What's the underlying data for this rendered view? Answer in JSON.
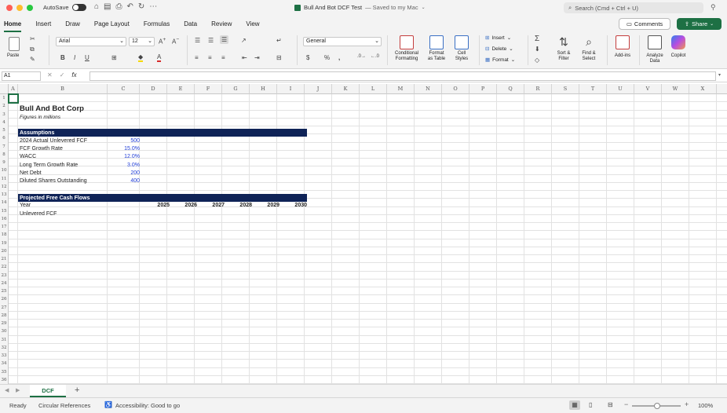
{
  "window": {
    "autosave_label": "AutoSave",
    "title": "Bull And Bot DCF Test",
    "title_suffix": "— Saved to my Mac",
    "search_placeholder": "Search (Cmd + Ctrl + U)"
  },
  "ribbon_tabs": [
    "Home",
    "Insert",
    "Draw",
    "Page Layout",
    "Formulas",
    "Data",
    "Review",
    "View"
  ],
  "ribbon_actions": {
    "comments": "Comments",
    "share": "Share"
  },
  "ribbon": {
    "paste": "Paste",
    "font_name": "Arial",
    "font_size": "12",
    "number_format": "General",
    "insert": "Insert",
    "delete": "Delete",
    "format": "Format",
    "conditional_formatting": [
      "Conditional",
      "Formatting"
    ],
    "format_as_table": [
      "Format",
      "as Table"
    ],
    "cell_styles": [
      "Cell",
      "Styles"
    ],
    "sort_filter": [
      "Sort &",
      "Filter"
    ],
    "find_select": [
      "Find &",
      "Select"
    ],
    "add_ins": "Add-ins",
    "analyze_data": [
      "Analyze",
      "Data"
    ],
    "copilot": "Copilot"
  },
  "formula_bar": {
    "name_box": "A1",
    "fx": "fx",
    "formula": ""
  },
  "columns": [
    "A",
    "B",
    "C",
    "D",
    "E",
    "F",
    "G",
    "H",
    "I",
    "J",
    "K",
    "L",
    "M",
    "N",
    "O",
    "P",
    "Q",
    "R",
    "S",
    "T",
    "U",
    "V",
    "W",
    "X",
    "Y"
  ],
  "rows": [
    "1",
    "2",
    "3",
    "4",
    "5",
    "6",
    "7",
    "8",
    "9",
    "10",
    "11",
    "12",
    "13",
    "14",
    "15",
    "16",
    "17",
    "18",
    "19",
    "20",
    "21",
    "22",
    "23",
    "24",
    "25",
    "26",
    "27",
    "28",
    "29",
    "30",
    "31",
    "32",
    "33",
    "34",
    "35",
    "36"
  ],
  "sheet": {
    "company": "Bull And Bot Corp",
    "subtitle": "Figures in millions",
    "assumptions_header": "Assumptions",
    "assumptions": [
      {
        "label": "2024 Actual Unlevered FCF",
        "value": "500"
      },
      {
        "label": "FCF Growth Rate",
        "value": "15.0%"
      },
      {
        "label": "WACC",
        "value": "12.0%"
      },
      {
        "label": "Long Term Growth Rate",
        "value": "3.0%"
      },
      {
        "label": "Net Debt",
        "value": "200"
      },
      {
        "label": "Diluted Shares Outstanding",
        "value": "400"
      }
    ],
    "projection_header": "Projected Free Cash Flows",
    "year_label": "Year",
    "years": [
      "2025",
      "2026",
      "2027",
      "2028",
      "2029",
      "2030"
    ],
    "ufcf_label": "Unlevered FCF"
  },
  "sheet_tabs": [
    "DCF"
  ],
  "status": {
    "ready": "Ready",
    "circular": "Circular References",
    "accessibility": "Accessibility: Good to go",
    "zoom": "100%"
  }
}
